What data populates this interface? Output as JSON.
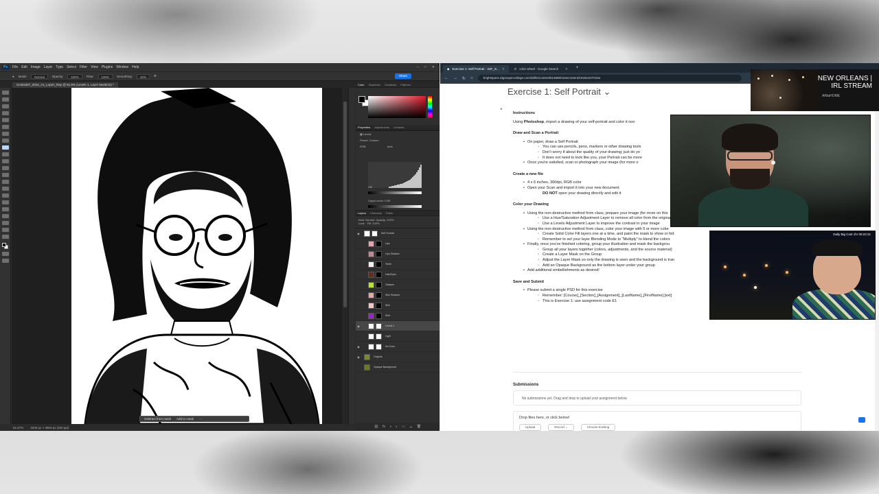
{
  "photoshop": {
    "menu": [
      "File",
      "Edit",
      "Image",
      "Layer",
      "Type",
      "Select",
      "Filter",
      "View",
      "Plugins",
      "Window",
      "Help"
    ],
    "document_tab": "GAM1507_2024_A1_Lopez_Ray @ 61.8% (Levels 1, Layer Mask/16) *",
    "options": {
      "mode_label": "Mode:",
      "mode": "Normal",
      "opacity_label": "Opacity:",
      "opacity": "100%",
      "flow_label": "Flow:",
      "flow": "100%",
      "smoothing_label": "Smoothing:",
      "smoothing": "10%"
    },
    "share_label": "Share",
    "status": {
      "zoom": "61.87%",
      "size": "3209 px × 3863 px (300 ppi)"
    },
    "context_bar": {
      "subtract": "Subtract from mask",
      "add": "Add to mask"
    },
    "panel_tabs_top": [
      "Color",
      "Swatches",
      "Gradients",
      "Patterns"
    ],
    "panel_tabs_props": [
      "Properties",
      "Adjustments",
      "Libraries"
    ],
    "properties": {
      "title": "Levels",
      "preset_label": "Preset:",
      "preset": "Custom",
      "channel": "RGB",
      "auto": "Auto",
      "input_values": [
        "235",
        "0.18",
        "255"
      ],
      "output_label": "Output Levels:",
      "output_values": [
        "0",
        "255"
      ]
    },
    "layers_tabs": [
      "Layers",
      "Channels",
      "Paths"
    ],
    "layers_filter": {
      "kind": "Kind",
      "blend": "Normal",
      "opacity_label": "Opacity:",
      "opacity": "100%",
      "lock_label": "Lock:",
      "fill_label": "Fill:",
      "fill": "100%"
    },
    "layers": [
      {
        "name": "Self Portrait",
        "kind": "group",
        "color": "#ffffff",
        "visible": true
      },
      {
        "name": "Lips",
        "kind": "fill",
        "color": "#e8a2ac",
        "visible": false
      },
      {
        "name": "Lips Shadow",
        "kind": "fill",
        "color": "#c78590",
        "visible": false
      },
      {
        "name": "Teeth",
        "kind": "fill",
        "color": "#f2f2f2",
        "visible": false
      },
      {
        "name": "Hair/Eyes",
        "kind": "fill",
        "color": "#6a2b16",
        "visible": false
      },
      {
        "name": "Glasses",
        "kind": "fill",
        "color": "#b8e234",
        "visible": false
      },
      {
        "name": "Skin Shadow",
        "kind": "fill",
        "color": "#e4a8a0",
        "visible": false
      },
      {
        "name": "Skin",
        "kind": "fill",
        "color": "#f2c6c6",
        "visible": false
      },
      {
        "name": "Shirt",
        "kind": "fill",
        "color": "#a21fd1",
        "visible": false
      },
      {
        "name": "Levels 1",
        "kind": "adjust",
        "color": "#ffffff",
        "visible": true,
        "selected": true
      },
      {
        "name": "Light",
        "kind": "adjust",
        "color": "#ffffff",
        "visible": false
      },
      {
        "name": "No Color",
        "kind": "adjust",
        "color": "#ffffff",
        "visible": true
      },
      {
        "name": "Original",
        "kind": "base",
        "color": "#7a8a2a",
        "visible": true
      },
      {
        "name": "Opaque Background",
        "kind": "base",
        "color": "#6a7a20",
        "visible": false
      }
    ]
  },
  "browser": {
    "tabs": [
      {
        "label": "Exercise 1: Self Portrait - 23F_G..."
      },
      {
        "label": "color wheel - Google Search"
      }
    ],
    "url": "brightspace.algonquincollege.com/d2l/le/content/613696/viewContent/10182167/View",
    "page": {
      "title": "Exercise 1: Self Portrait ⌄",
      "instructions_heading": "Instructions",
      "intro_pre": "Using ",
      "intro_bold": "Photoshop",
      "intro_post": ", import a drawing of your self-portrait and color it non",
      "sections": [
        {
          "heading": "Draw and Scan a Portrait",
          "items": [
            {
              "level": 1,
              "text": "On paper, draw a Self Portrait"
            },
            {
              "level": 2,
              "text": "You can use pencils, pens, markers or other drawing tools"
            },
            {
              "level": 2,
              "text": "Don't worry if about the quality of your drawing; just do yo"
            },
            {
              "level": 2,
              "text": "It does not need to look like you, your Portrait can be more"
            },
            {
              "level": 1,
              "text": "Once you're satisfied, scan or photograph your image (for more o"
            }
          ]
        },
        {
          "heading": "Create a new file",
          "items": [
            {
              "level": 1,
              "text": "4 x 6 inches, 300dpi, RGB color"
            },
            {
              "level": 1,
              "text": "Open your Scan and import it into your new document"
            },
            {
              "level": 3,
              "bold": "DO NOT",
              "text": " open your drawing directly and edit it"
            }
          ]
        },
        {
          "heading": "Color your Drawing",
          "items": [
            {
              "level": 1,
              "text": "Using the non-destructive method from class, prepare your image (for more on this"
            },
            {
              "level": 2,
              "text": "Use a Hue/Saturation Adjustment Layer to remove all color from the original"
            },
            {
              "level": 2,
              "text": "Use a Levels Adjustment Layer to improve the contrast in your image"
            },
            {
              "level": 1,
              "text": "Using the non-destructive method from class, color your image with 5 or more color"
            },
            {
              "level": 2,
              "text": "Create Solid Color Fill layers one at a time, and paint the mask to show or hid"
            },
            {
              "level": 2,
              "text": "Remember to set your layer Blending Mode to \"Multiply\" to blend the colors"
            },
            {
              "level": 1,
              "text": "Finally, once you've finished coloring, group your illustration and mask the backgrou"
            },
            {
              "level": 2,
              "text": "Group all your layers together (colors, adjustments, and the source material)"
            },
            {
              "level": 2,
              "text": "Create a Layer Mask on the Group"
            },
            {
              "level": 2,
              "text": "Adjust the Layer Mask so only the drawing is seen and the background is tran"
            },
            {
              "level": 2,
              "text": "Add an Opaque Background as the bottom layer under your group"
            },
            {
              "level": 1,
              "text": "Add additional embellishments as desired!"
            }
          ]
        },
        {
          "heading": "Save and Submit",
          "items": [
            {
              "level": 1,
              "text": "Please submit a single PSD for this exercise"
            },
            {
              "level": 2,
              "text": "Remember: [Course]_[Section]_[Assignment]_[LastName]_[FirstName].[ext]"
            },
            {
              "level": 2,
              "text": "This is Exercise 1: use assignment code E1"
            }
          ]
        }
      ],
      "submissions_heading": "Submissions",
      "submissions_empty": "No submissions yet. Drag and drop to upload your assignment below.",
      "drop_label": "Drop files here, or click below!",
      "drop_buttons": [
        "Upload",
        "Record ⌄",
        "Choose Existing"
      ]
    }
  },
  "overlays": {
    "nola_title": "NEW ORLEANS | IRL STREAM",
    "nola_sub": "ARtaHOME",
    "cam2_tag": "Daily Big Cost 1hr 00:22:21"
  }
}
